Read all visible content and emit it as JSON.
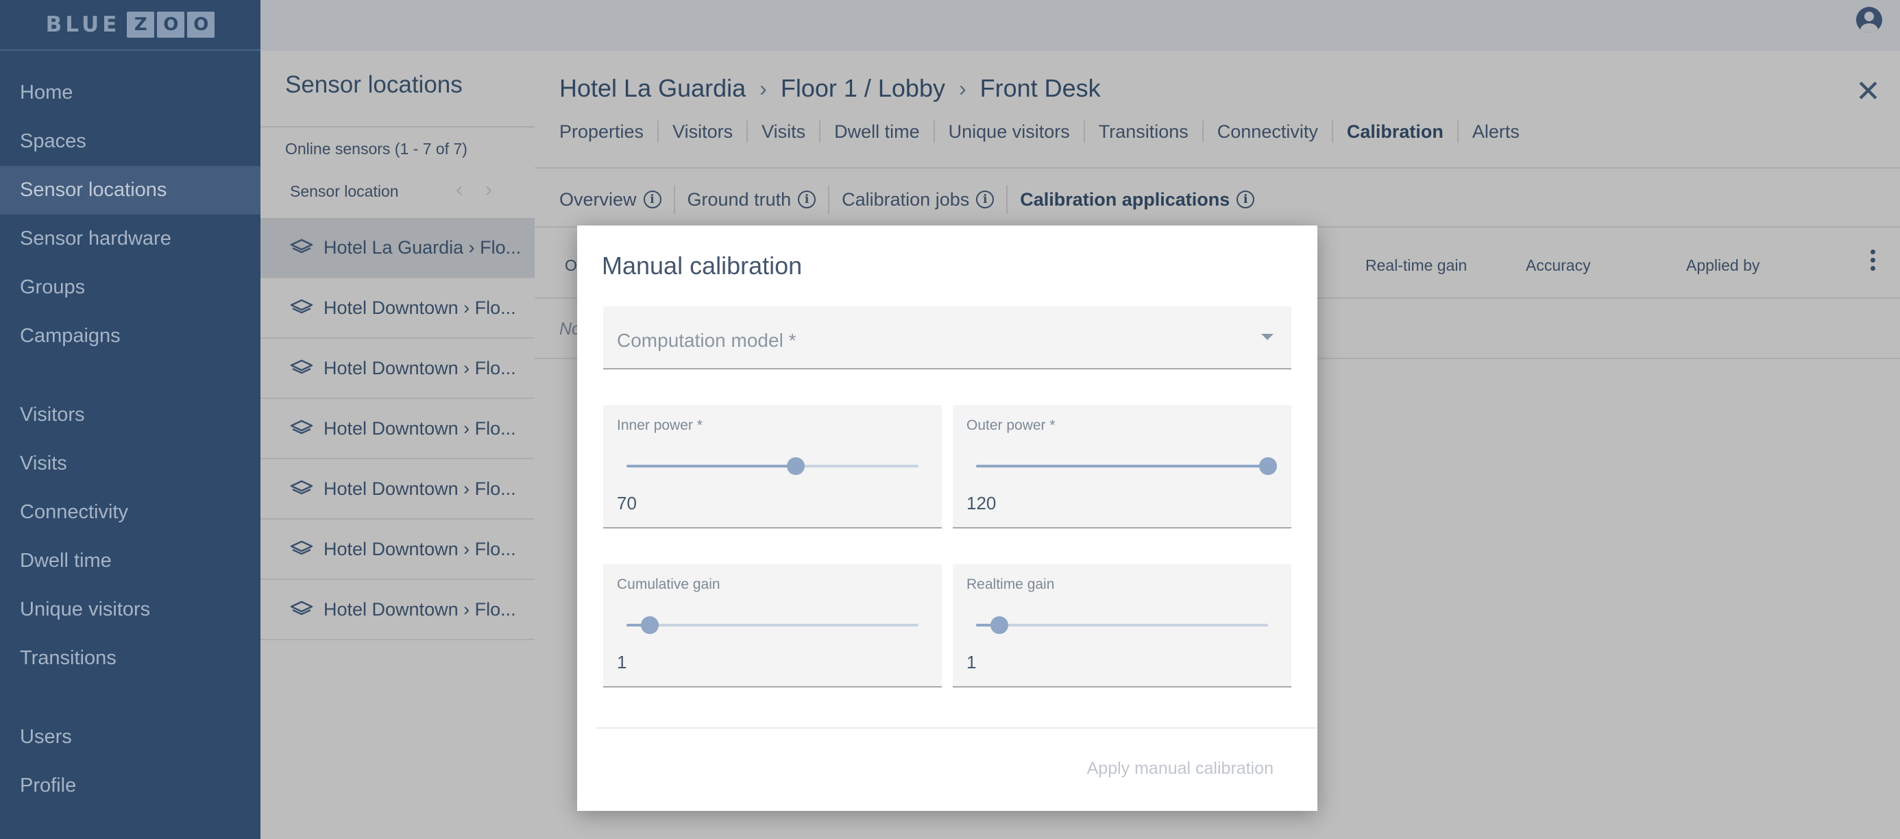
{
  "app": {
    "logo_left": "BLUE",
    "logo_right": [
      "Z",
      "O",
      "O"
    ]
  },
  "sidebar": {
    "items_top": [
      "Home",
      "Spaces",
      "Sensor locations",
      "Sensor hardware",
      "Groups",
      "Campaigns"
    ],
    "items_mid": [
      "Visitors",
      "Visits",
      "Connectivity",
      "Dwell time",
      "Unique visitors",
      "Transitions"
    ],
    "items_bottom": [
      "Users",
      "Profile"
    ],
    "active": "Sensor locations"
  },
  "list_panel": {
    "title": "Sensor locations",
    "online_count": "Online sensors (1 - 7 of 7)",
    "column_header": "Sensor location",
    "rows": [
      "Hotel La Guardia › Flo...",
      "Hotel Downtown › Flo...",
      "Hotel Downtown › Flo...",
      "Hotel Downtown › Flo...",
      "Hotel Downtown › Flo...",
      "Hotel Downtown › Flo...",
      "Hotel Downtown › Flo..."
    ]
  },
  "detail": {
    "breadcrumb": [
      "Hotel La Guardia",
      "Floor 1 / Lobby",
      "Front Desk"
    ],
    "tabs": [
      "Properties",
      "Visitors",
      "Visits",
      "Dwell time",
      "Unique visitors",
      "Transitions",
      "Connectivity",
      "Calibration",
      "Alerts"
    ],
    "active_tab": "Calibration",
    "subtabs": [
      "Overview",
      "Ground truth",
      "Calibration jobs",
      "Calibration applications"
    ],
    "active_subtab": "Calibration applications",
    "table_headers": {
      "first": "O",
      "realtime_gain": "Real-time gain",
      "accuracy": "Accuracy",
      "applied_by": "Applied by"
    },
    "no_data_fragment": "No"
  },
  "modal": {
    "title": "Manual calibration",
    "computation_model_placeholder": "Computation model *",
    "sliders": [
      {
        "label": "Inner power *",
        "value": "70",
        "fraction": 0.58
      },
      {
        "label": "Outer power *",
        "value": "120",
        "fraction": 1.0
      },
      {
        "label": "Cumulative gain",
        "value": "1",
        "fraction": 0.08
      },
      {
        "label": "Realtime gain",
        "value": "1",
        "fraction": 0.08
      }
    ],
    "apply_label": "Apply manual calibration"
  },
  "colors": {
    "sidebar_bg": "#2f4a6b",
    "accent_slider": "#8fa6c6",
    "overlay_gray": "#bdbdbd"
  }
}
